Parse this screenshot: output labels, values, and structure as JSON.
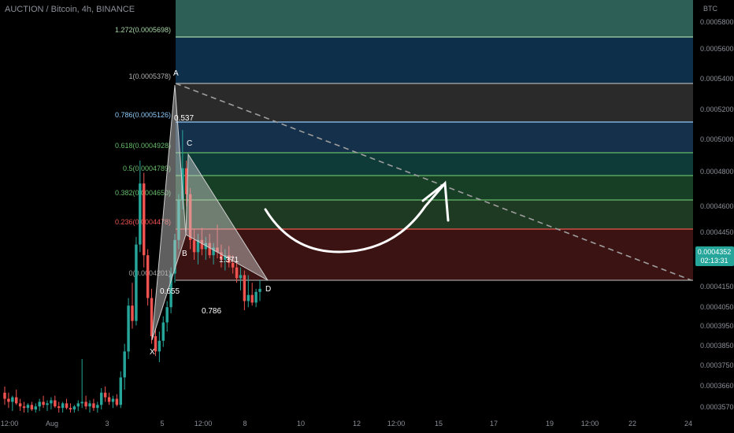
{
  "header": {
    "symbol_title": "AUCTION / Bitcoin, 4h, BINANCE"
  },
  "price_axis": {
    "unit_label": "BTC",
    "ticks": [
      "0.0005800",
      "0.0005600",
      "0.0005400",
      "0.0005200",
      "0.0005000",
      "0.0004800",
      "0.0004600",
      "0.0004450",
      "0.0004150",
      "0.0004050",
      "0.0003950",
      "0.0003850",
      "0.0003750",
      "0.0003660",
      "0.0003570"
    ],
    "current_price": "0.0004352",
    "countdown": "02:13:31"
  },
  "time_axis": {
    "ticks": [
      "12:00",
      "Aug",
      "3",
      "5",
      "12:00",
      "8",
      "10",
      "12",
      "12:00",
      "15",
      "17",
      "19",
      "12:00",
      "22",
      "24"
    ]
  },
  "colors": {
    "bg": "#000000",
    "up": "#26a69a",
    "down": "#ef5350",
    "price_badge": "#26a69a"
  },
  "fib_levels": [
    {
      "label": "1.272(0.0005698)",
      "color": "#a5d6a7"
    },
    {
      "label": "1(0.0005378)",
      "color": "#b0b0b0"
    },
    {
      "label": "0.786(0.0005126)",
      "color": "#90caf9"
    },
    {
      "label": "0.618(0.0004928)",
      "color": "#66bb6a"
    },
    {
      "label": "0.5(0.0004789)",
      "color": "#66bb6a"
    },
    {
      "label": "0.382(0.0004650)",
      "color": "#66bb6a"
    },
    {
      "label": "0.236(0.0004478)",
      "color": "#ef5350"
    },
    {
      "label": "0(0.0004201)",
      "color": "#9e9e9e"
    }
  ],
  "pattern": {
    "points": [
      "X",
      "A",
      "B",
      "C",
      "D"
    ],
    "ratios": [
      "0.655",
      "0.786",
      "1.371",
      "0.537"
    ]
  },
  "chart_data": {
    "type": "candlestick",
    "title": "AUCTION / Bitcoin, 4h, BINANCE",
    "y_unit": "BTC",
    "ylim": [
      0.000355,
      0.00062
    ],
    "candles_ohlc": [
      [
        0.000368,
        0.000372,
        0.00036,
        0.000364
      ],
      [
        0.000364,
        0.000368,
        0.000358,
        0.000362
      ],
      [
        0.000362,
        0.000366,
        0.000356,
        0.000365
      ],
      [
        0.000365,
        0.00037,
        0.00036,
        0.000361
      ],
      [
        0.000361,
        0.000364,
        0.000356,
        0.000359
      ],
      [
        0.000359,
        0.000362,
        0.000355,
        0.000358
      ],
      [
        0.000358,
        0.000361,
        0.000355,
        0.00036
      ],
      [
        0.00036,
        0.000362,
        0.000356,
        0.000357
      ],
      [
        0.000357,
        0.000361,
        0.000355,
        0.000359
      ],
      [
        0.000359,
        0.000364,
        0.000356,
        0.000362
      ],
      [
        0.000362,
        0.000366,
        0.000358,
        0.00036
      ],
      [
        0.00036,
        0.000363,
        0.000356,
        0.000361
      ],
      [
        0.000361,
        0.000365,
        0.000357,
        0.000363
      ],
      [
        0.000363,
        0.000366,
        0.000358,
        0.000359
      ],
      [
        0.000359,
        0.000362,
        0.000355,
        0.000358
      ],
      [
        0.000358,
        0.000362,
        0.000355,
        0.000361
      ],
      [
        0.000361,
        0.000364,
        0.000357,
        0.000358
      ],
      [
        0.000358,
        0.000361,
        0.000355,
        0.000357
      ],
      [
        0.000357,
        0.00036,
        0.000355,
        0.000359
      ],
      [
        0.000359,
        0.000363,
        0.000356,
        0.000361
      ],
      [
        0.000361,
        0.00039,
        0.000358,
        0.000362
      ],
      [
        0.000362,
        0.000366,
        0.000357,
        0.000359
      ],
      [
        0.000359,
        0.000363,
        0.000355,
        0.000361
      ],
      [
        0.000361,
        0.000364,
        0.000356,
        0.000358
      ],
      [
        0.000358,
        0.000362,
        0.000355,
        0.00036
      ],
      [
        0.00036,
        0.000371,
        0.000357,
        0.000368
      ],
      [
        0.000368,
        0.000372,
        0.000362,
        0.000365
      ],
      [
        0.000365,
        0.000368,
        0.00036,
        0.000362
      ],
      [
        0.000362,
        0.000366,
        0.000358,
        0.000364
      ],
      [
        0.000364,
        0.000367,
        0.000359,
        0.00036
      ],
      [
        0.00036,
        0.000382,
        0.000358,
        0.000378
      ],
      [
        0.000378,
        0.0004,
        0.00037,
        0.000395
      ],
      [
        0.000395,
        0.00043,
        0.00039,
        0.000425
      ],
      [
        0.000425,
        0.00044,
        0.00041,
        0.000415
      ],
      [
        0.000415,
        0.00047,
        0.000412,
        0.000465
      ],
      [
        0.000465,
        0.00052,
        0.00046,
        0.000505
      ],
      [
        0.000505,
        0.000512,
        0.00045,
        0.000458
      ],
      [
        0.000458,
        0.000462,
        0.000425,
        0.00043
      ],
      [
        0.00043,
        0.000436,
        0.0004,
        0.000405
      ],
      [
        0.000405,
        0.00041,
        0.000392,
        0.000395
      ],
      [
        0.000395,
        0.000408,
        0.000388,
        0.000402
      ],
      [
        0.000402,
        0.000418,
        0.000398,
        0.000414
      ],
      [
        0.000414,
        0.000428,
        0.000408,
        0.000424
      ],
      [
        0.000424,
        0.00045,
        0.00042,
        0.000446
      ],
      [
        0.000446,
        0.000472,
        0.00044,
        0.000468
      ],
      [
        0.000468,
        0.000498,
        0.000462,
        0.000494
      ],
      [
        0.000494,
        0.00054,
        0.000488,
        0.000515
      ],
      [
        0.000515,
        0.00052,
        0.00049,
        0.000498
      ],
      [
        0.000498,
        0.000502,
        0.000462,
        0.000468
      ],
      [
        0.000468,
        0.000475,
        0.000455,
        0.00046
      ],
      [
        0.00046,
        0.000472,
        0.000452,
        0.000468
      ],
      [
        0.000468,
        0.000476,
        0.000458,
        0.000462
      ],
      [
        0.000462,
        0.00047,
        0.000455,
        0.000466
      ],
      [
        0.000466,
        0.000472,
        0.000456,
        0.000458
      ],
      [
        0.000458,
        0.000466,
        0.000452,
        0.000463
      ],
      [
        0.000463,
        0.000478,
        0.000456,
        0.00046
      ],
      [
        0.00046,
        0.000465,
        0.00045,
        0.000455
      ],
      [
        0.000455,
        0.000462,
        0.000448,
        0.000458
      ],
      [
        0.000458,
        0.000464,
        0.00045,
        0.000453
      ],
      [
        0.000453,
        0.000458,
        0.000446,
        0.00045
      ],
      [
        0.00045,
        0.000455,
        0.00044,
        0.000443
      ],
      [
        0.000443,
        0.00045,
        0.000435,
        0.000445
      ],
      [
        0.000445,
        0.000448,
        0.000422,
        0.000428
      ],
      [
        0.000428,
        0.000445,
        0.000424,
        0.000432
      ],
      [
        0.000432,
        0.00044,
        0.000425,
        0.000427
      ],
      [
        0.000427,
        0.000436,
        0.000424,
        0.000434
      ],
      [
        0.000434,
        0.000442,
        0.000428,
        0.000436
      ]
    ]
  }
}
